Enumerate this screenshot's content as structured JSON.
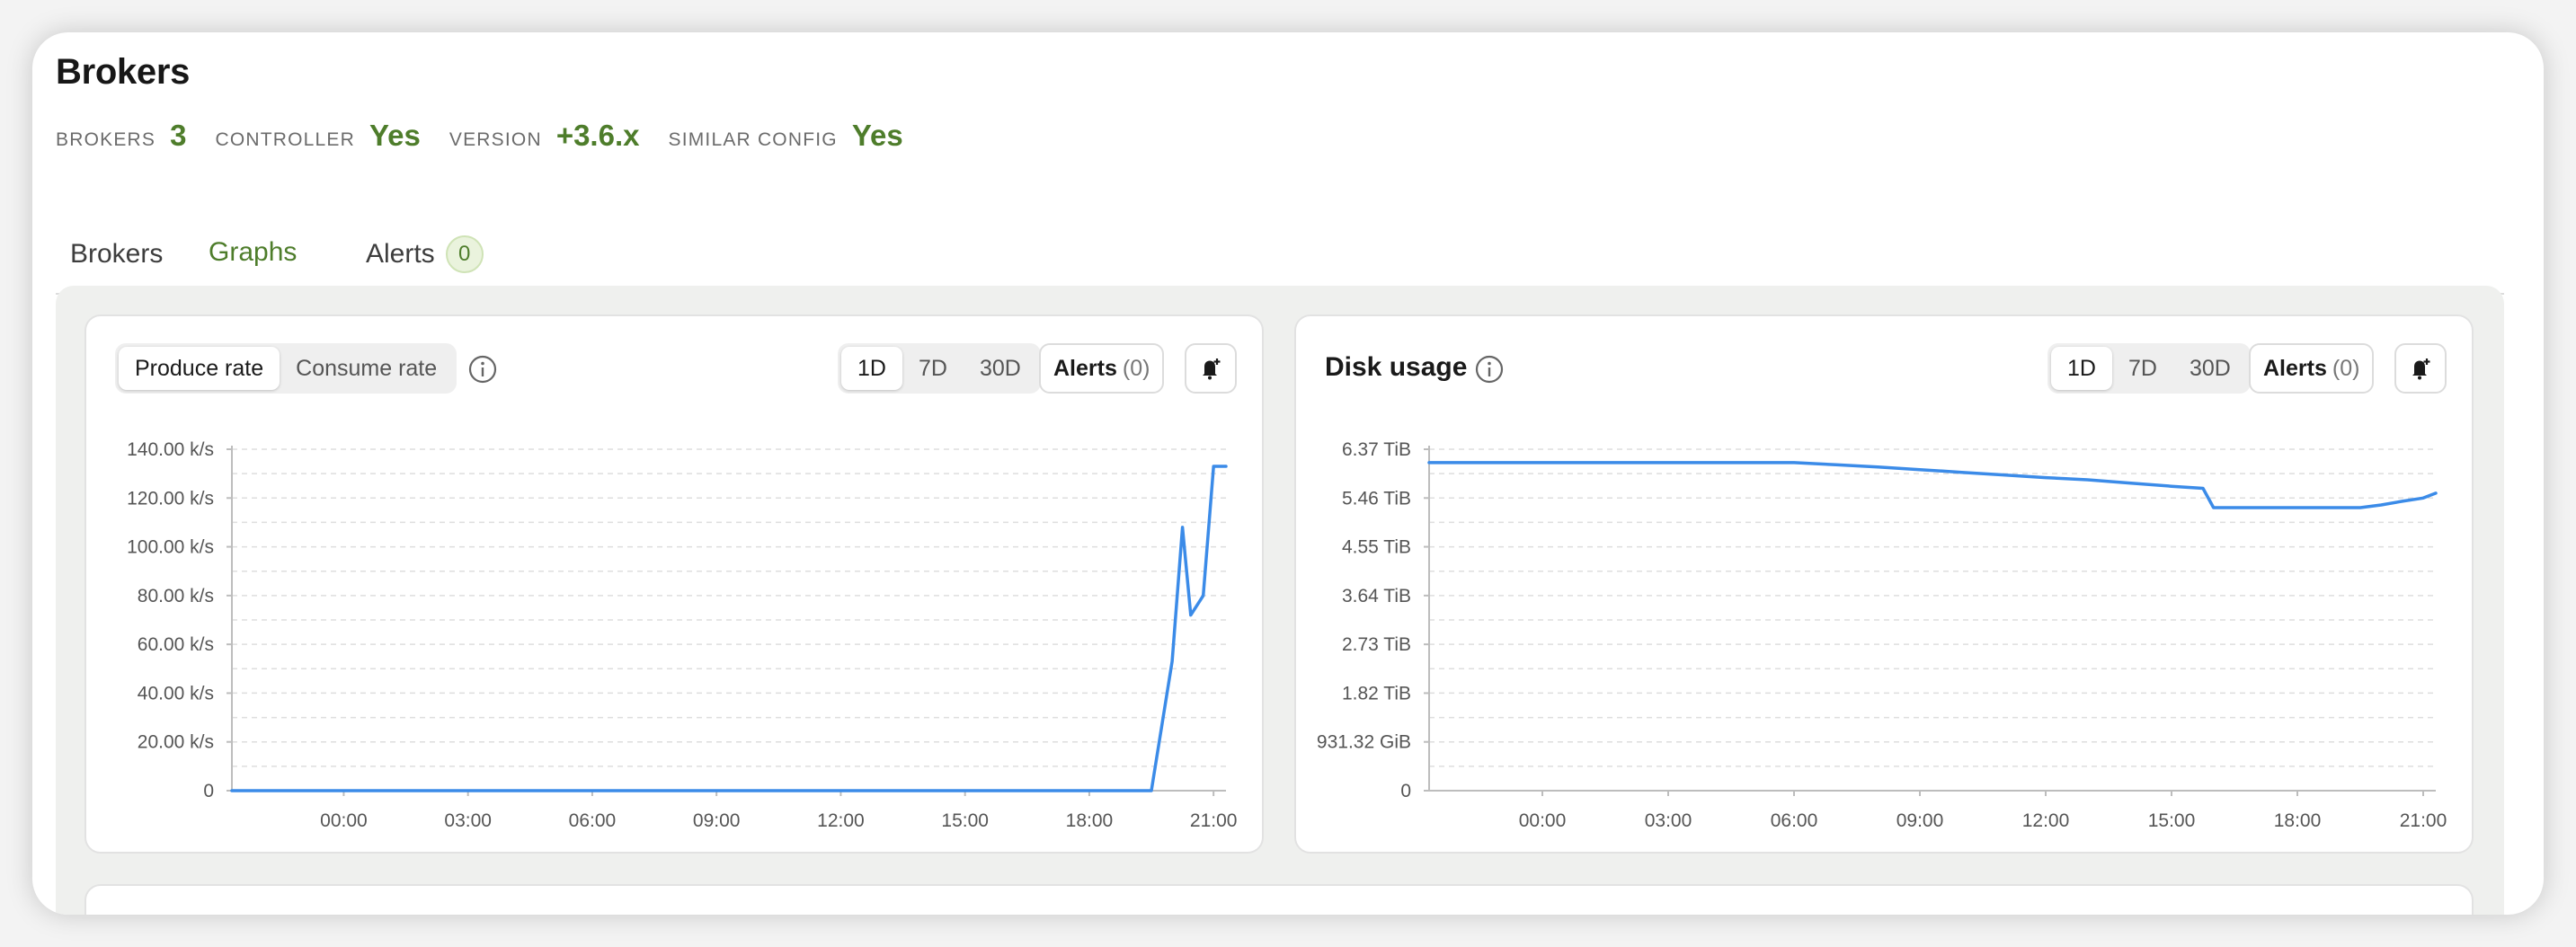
{
  "page": {
    "title": "Brokers"
  },
  "stats": [
    {
      "label": "BROKERS",
      "value": "3"
    },
    {
      "label": "CONTROLLER",
      "value": "Yes"
    },
    {
      "label": "VERSION",
      "value": "+3.6.x"
    },
    {
      "label": "SIMILAR CONFIG",
      "value": "Yes"
    }
  ],
  "tabs": [
    {
      "label": "Brokers",
      "active": false
    },
    {
      "label": "Graphs",
      "active": true
    },
    {
      "label": "Alerts",
      "active": false,
      "badge": "0"
    }
  ],
  "colors": {
    "accent": "#4e7d2b",
    "line": "#3b8be8"
  },
  "left_card": {
    "metric_tabs": [
      "Produce rate",
      "Consume rate"
    ],
    "active_metric": "Produce rate",
    "ranges": [
      "1D",
      "7D",
      "30D"
    ],
    "active_range": "1D",
    "alerts_label": "Alerts",
    "alerts_count": "(0)",
    "info_icon": "info-icon",
    "bell_icon": "bell-plus-icon"
  },
  "right_card": {
    "title": "Disk usage",
    "ranges": [
      "1D",
      "7D",
      "30D"
    ],
    "active_range": "1D",
    "alerts_label": "Alerts",
    "alerts_count": "(0)",
    "info_icon": "info-icon",
    "bell_icon": "bell-plus-icon"
  },
  "chart_data": [
    {
      "type": "line",
      "title": "",
      "x_ticks": [
        "00:00",
        "03:00",
        "06:00",
        "09:00",
        "12:00",
        "15:00",
        "18:00",
        "21:00"
      ],
      "y_ticks": [
        "0",
        "20.00 k/s",
        "40.00 k/s",
        "60.00 k/s",
        "80.00 k/s",
        "100.00 k/s",
        "120.00 k/s",
        "140.00 k/s"
      ],
      "ylim": [
        0,
        140
      ],
      "xlim": [
        -2.7,
        21.3
      ],
      "x_unit": "hours",
      "grid": true,
      "series": [
        {
          "x": [
            -2.7,
            19.5,
            20.0,
            20.25,
            20.45,
            20.75,
            21.0,
            21.3
          ],
          "y": [
            0,
            0,
            53,
            108,
            72,
            80,
            133,
            133
          ]
        }
      ]
    },
    {
      "type": "line",
      "title": "",
      "x_ticks": [
        "00:00",
        "03:00",
        "06:00",
        "09:00",
        "12:00",
        "15:00",
        "18:00",
        "21:00"
      ],
      "y_ticks": [
        "0",
        "931.32 GiB",
        "1.82 TiB",
        "2.73 TiB",
        "3.64 TiB",
        "4.55 TiB",
        "5.46 TiB",
        "6.37 TiB"
      ],
      "ylim": [
        0,
        6.37
      ],
      "xlim": [
        -2.7,
        21.3
      ],
      "x_unit": "hours",
      "grid": true,
      "series": [
        {
          "x": [
            -2.7,
            6.0,
            7.0,
            8.0,
            9.0,
            10.0,
            11.0,
            12.0,
            13.0,
            14.0,
            15.0,
            15.75,
            16.0,
            17.0,
            18.0,
            19.0,
            19.5,
            20.0,
            20.5,
            21.0,
            21.3
          ],
          "y": [
            6.12,
            6.12,
            6.08,
            6.04,
            5.99,
            5.94,
            5.89,
            5.84,
            5.8,
            5.74,
            5.68,
            5.64,
            5.28,
            5.28,
            5.28,
            5.28,
            5.28,
            5.33,
            5.4,
            5.46,
            5.55
          ]
        }
      ]
    }
  ]
}
